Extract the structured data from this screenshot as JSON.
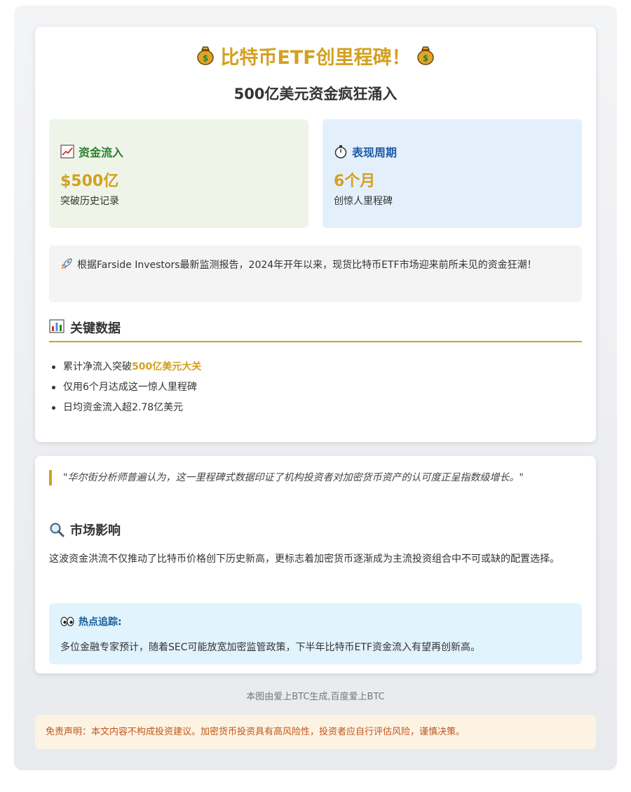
{
  "header": {
    "title": "比特币ETF创里程碑！",
    "subtitle": "500亿美元资金疯狂涌入"
  },
  "stats": [
    {
      "heading": "资金流入",
      "value": "$500亿",
      "desc": "突破历史记录",
      "icon": "chart-up-icon"
    },
    {
      "heading": "表现周期",
      "value": "6个月",
      "desc": "创惊人里程碑",
      "icon": "stopwatch-icon"
    }
  ],
  "intro": {
    "text": "根据Farside Investors最新监测报告，2024年开年以来，现货比特币ETF市场迎来前所未见的资金狂潮！"
  },
  "key_data": {
    "title": "关键数据",
    "items": [
      {
        "prefix": "累计净流入突破",
        "highlight": "500亿美元大关"
      },
      {
        "text": "仅用6个月达成这一惊人里程碑"
      },
      {
        "text": "日均资金流入超2.78亿美元"
      }
    ]
  },
  "quote": {
    "text": "\"华尔街分析师普遍认为，这一里程碑式数据印证了机构投资者对加密货币资产的认可度正呈指数级增长。\""
  },
  "market": {
    "title": "市场影响",
    "text": "这波资金洪流不仅推动了比特币价格创下历史新高，更标志着加密货币逐渐成为主流投资组合中不可或缺的配置选择。"
  },
  "hot": {
    "title": "热点追踪:",
    "text": "多位金融专家预计，随着SEC可能放宽加密监管政策，下半年比特币ETF资金流入有望再创新高。"
  },
  "footer": {
    "note": "本图由爱上BTC生成,百度爱上BTC",
    "disclaimer": "免责声明：本文内容不构成投资建议。加密货币投资具有高风险性，投资者应自行评估风险，谨慎决策。"
  },
  "colors": {
    "accent": "#d4a020",
    "green_card": "#eef5e8",
    "blue_card": "#e3f0fc",
    "hot_card": "#e1f3fd",
    "disclaimer_bg": "#fdf3e3"
  }
}
